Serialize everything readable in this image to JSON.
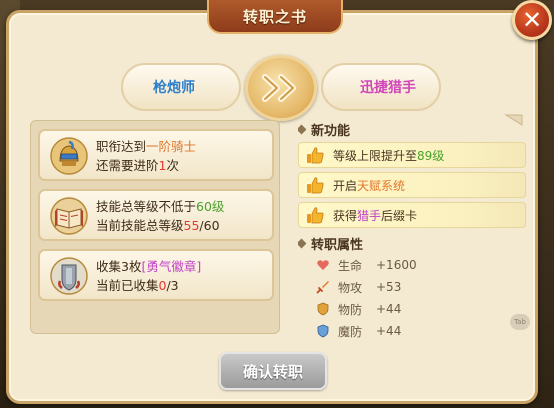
{
  "dialog": {
    "title": "转职之书",
    "from_class": "枪炮师",
    "to_class": "迅捷猎手",
    "confirm_label": "确认转职"
  },
  "requirements": [
    {
      "icon": "knight-helmet-icon",
      "line1_prefix": "职衔达到",
      "line1_highlight": "一阶骑士",
      "line1_suffix": "",
      "line2_prefix": "还需要进阶",
      "line2_value": "1",
      "line2_suffix": "次"
    },
    {
      "icon": "skill-book-icon",
      "line1_prefix": "技能总等级不低于",
      "line1_highlight": "60级",
      "line1_suffix": "",
      "line2_prefix": "当前技能总等级",
      "line2_value": "55",
      "line2_suffix": "/60"
    },
    {
      "icon": "courage-badge-icon",
      "line1_prefix": "收集3枚",
      "line1_highlight": "[勇气徽章]",
      "line1_suffix": "",
      "line2_prefix": "当前已收集",
      "line2_value": "0",
      "line2_suffix": "/3"
    }
  ],
  "new_features": {
    "header": "新功能",
    "items": [
      {
        "prefix": "等级上限提升至",
        "highlight": "89级",
        "suffix": ""
      },
      {
        "prefix": "开启",
        "highlight": "天赋系统",
        "suffix": ""
      },
      {
        "prefix": "获得",
        "highlight": "猎手",
        "suffix": "后缀卡"
      }
    ]
  },
  "attributes": {
    "header": "转职属性",
    "items": [
      {
        "icon": "heart-icon",
        "name": "生命",
        "value": "+1600"
      },
      {
        "icon": "sword-icon",
        "name": "物攻",
        "value": "+53"
      },
      {
        "icon": "shield-icon",
        "name": "物防",
        "value": "+44"
      },
      {
        "icon": "magic-shield-icon",
        "name": "魔防",
        "value": "+44"
      }
    ]
  },
  "tag_chip": "Tab",
  "colors": {
    "from_class": "#2d7fc9",
    "to_class": "#d046b8",
    "highlight_orange": "#e0782c",
    "highlight_green": "#4aa12a",
    "highlight_red": "#e33a2e",
    "highlight_purple": "#c140c9"
  }
}
